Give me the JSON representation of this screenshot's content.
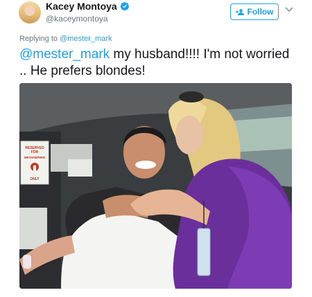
{
  "author": {
    "display_name": "Kacey Montoya",
    "handle": "@kaceymontoya",
    "verified_icon": "verified-badge-icon",
    "avatar_icon": "profile-avatar"
  },
  "follow_button": {
    "label": "Follow",
    "icon": "add-user-icon"
  },
  "menu_icon": "chevron-down-icon",
  "reply": {
    "prefix": "Replying to ",
    "to": "@mester_mark"
  },
  "tweet": {
    "mention": "@mester_mark",
    "text": " my husband!!!! I'm not worried .. He prefers blondes!"
  },
  "media": {
    "sign_lines": [
      "RESERVED",
      "FOR",
      "METHAMPHER",
      "ONLY"
    ]
  },
  "colors": {
    "accent": "#1da1f2",
    "text": "#14171a",
    "secondary_text": "#657786"
  }
}
